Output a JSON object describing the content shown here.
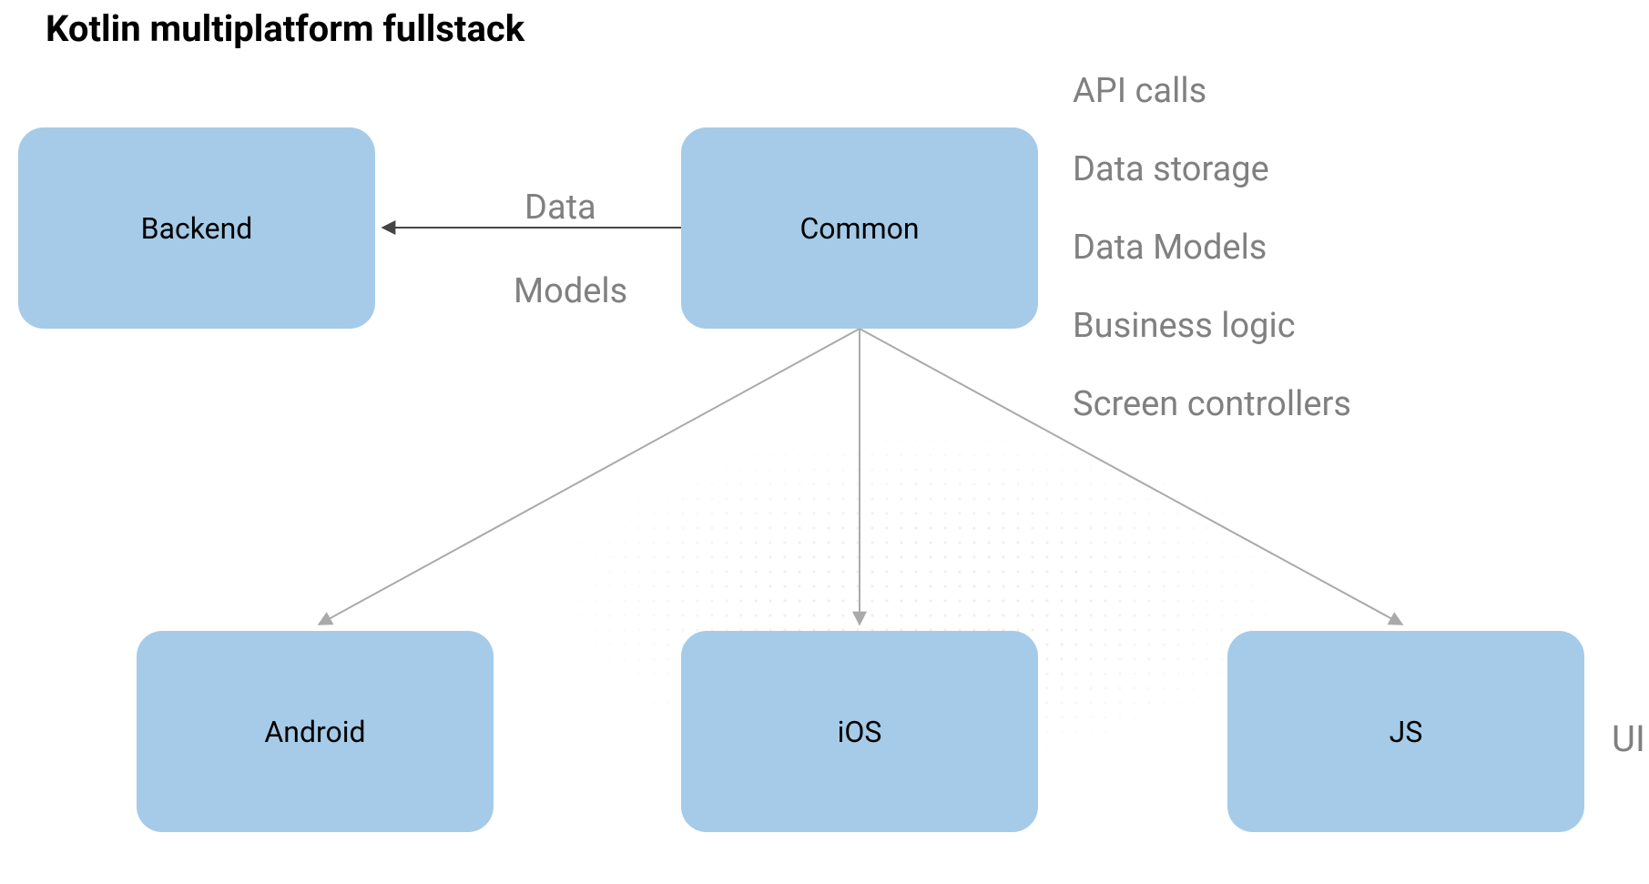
{
  "title": "Kotlin multiplatform fullstack",
  "nodes": {
    "backend": "Backend",
    "common": "Common",
    "android": "Android",
    "ios": "iOS",
    "js": "JS"
  },
  "edge_labels": {
    "data": "Data",
    "models": "Models"
  },
  "annotations": {
    "item1": "API calls",
    "item2": "Data storage",
    "item3": "Data Models",
    "item4": "Business logic",
    "item5": "Screen controllers"
  },
  "side_label": "UI",
  "chart_data": {
    "type": "diagram",
    "title": "Kotlin multiplatform fullstack",
    "nodes": [
      {
        "id": "backend",
        "label": "Backend"
      },
      {
        "id": "common",
        "label": "Common"
      },
      {
        "id": "android",
        "label": "Android"
      },
      {
        "id": "ios",
        "label": "iOS"
      },
      {
        "id": "js",
        "label": "JS"
      }
    ],
    "edges": [
      {
        "from": "common",
        "to": "backend",
        "label": "Data Models"
      },
      {
        "from": "common",
        "to": "android"
      },
      {
        "from": "common",
        "to": "ios"
      },
      {
        "from": "common",
        "to": "js"
      }
    ],
    "annotations_for": "common",
    "annotations": [
      "API calls",
      "Data storage",
      "Data Models",
      "Business logic",
      "Screen controllers"
    ],
    "side_annotation": "UI"
  }
}
